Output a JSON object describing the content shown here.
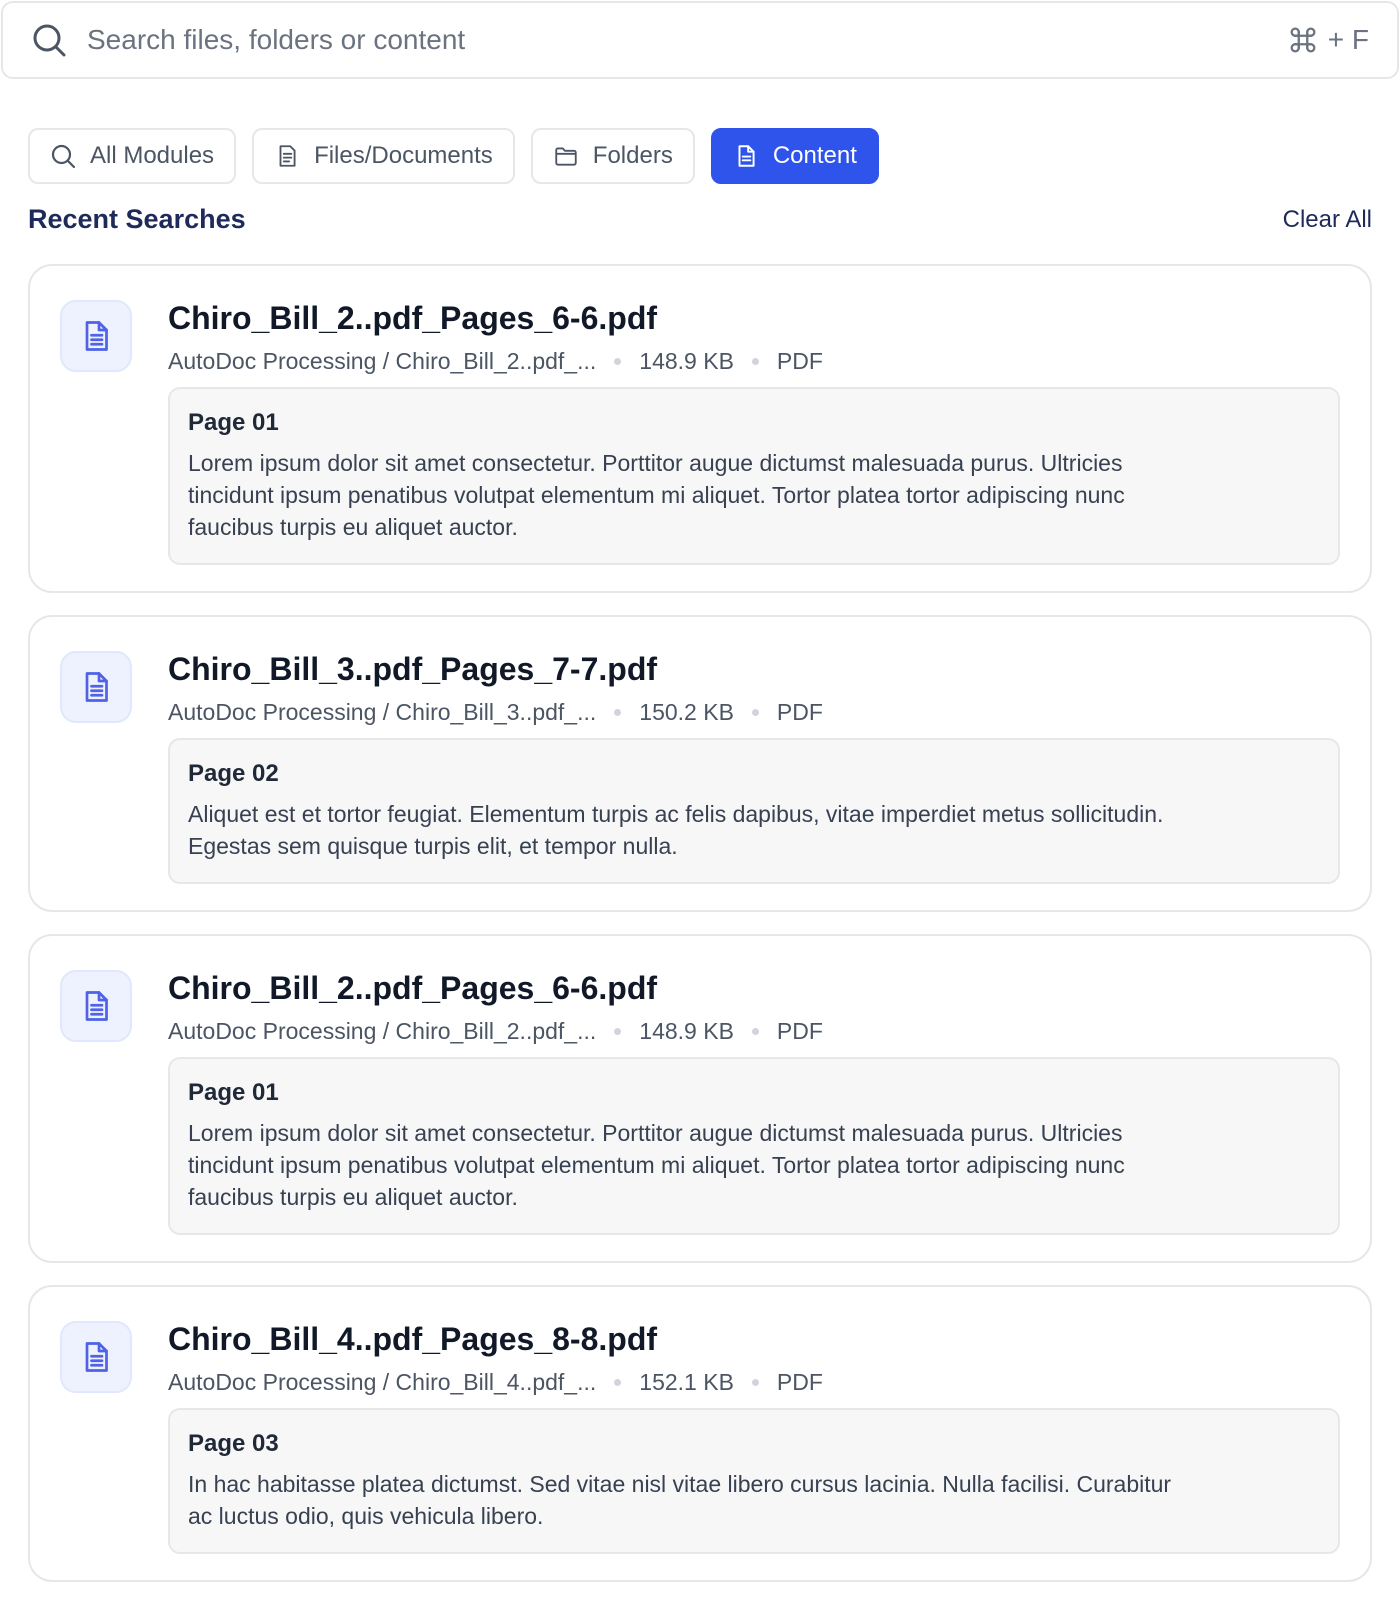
{
  "search": {
    "placeholder": "Search files, folders or content",
    "value": "",
    "shortcut_key": "+ F"
  },
  "filters": [
    {
      "label": "All Modules",
      "icon": "search-icon",
      "active": false
    },
    {
      "label": "Files/Documents",
      "icon": "file-list-icon",
      "active": false
    },
    {
      "label": "Folders",
      "icon": "folder-icon",
      "active": false
    },
    {
      "label": "Content",
      "icon": "document-icon",
      "active": true
    }
  ],
  "recent": {
    "title": "Recent Searches",
    "clear_label": "Clear All"
  },
  "results": [
    {
      "name": "Chiro_Bill_2..pdf_Pages_6-6.pdf",
      "path": "AutoDoc Processing / Chiro_Bill_2..pdf_...",
      "size": "148.9 KB",
      "type": "PDF",
      "page": "Page 01",
      "excerpt": "Lorem ipsum dolor sit amet consectetur. Porttitor augue dictumst malesuada purus. Ultricies tincidunt ipsum penatibus volutpat elementum mi aliquet. Tortor platea tortor adipiscing nunc faucibus turpis eu aliquet auctor."
    },
    {
      "name": "Chiro_Bill_3..pdf_Pages_7-7.pdf",
      "path": "AutoDoc Processing / Chiro_Bill_3..pdf_...",
      "size": "150.2 KB",
      "type": "PDF",
      "page": "Page 02",
      "excerpt": "Aliquet est et tortor feugiat. Elementum turpis ac felis dapibus, vitae imperdiet metus sollicitudin. Egestas sem quisque turpis elit, et tempor nulla."
    },
    {
      "name": "Chiro_Bill_2..pdf_Pages_6-6.pdf",
      "path": "AutoDoc Processing / Chiro_Bill_2..pdf_...",
      "size": "148.9 KB",
      "type": "PDF",
      "page": "Page 01",
      "excerpt": "Lorem ipsum dolor sit amet consectetur. Porttitor augue dictumst malesuada purus. Ultricies tincidunt ipsum penatibus volutpat elementum mi aliquet. Tortor platea tortor adipiscing nunc faucibus turpis eu aliquet auctor."
    },
    {
      "name": "Chiro_Bill_4..pdf_Pages_8-8.pdf",
      "path": "AutoDoc Processing / Chiro_Bill_4..pdf_...",
      "size": "152.1 KB",
      "type": "PDF",
      "page": "Page 03",
      "excerpt": "In hac habitasse platea dictumst. Sed vitae nisl vitae libero cursus lacinia. Nulla facilisi. Curabitur ac luctus odio, quis vehicula libero."
    }
  ],
  "colors": {
    "accent": "#2f54eb",
    "heading": "#1e2a5a",
    "icon_badge_bg": "#eef2ff"
  }
}
